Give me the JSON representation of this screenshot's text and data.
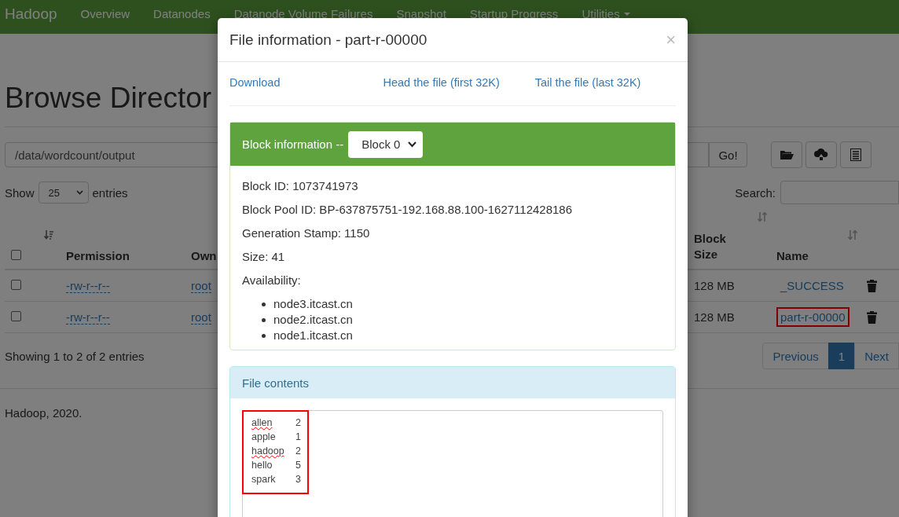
{
  "navbar": {
    "brand": "Hadoop",
    "items": [
      "Overview",
      "Datanodes",
      "Datanode Volume Failures",
      "Snapshot",
      "Startup Progress",
      "Utilities"
    ]
  },
  "page": {
    "title": "Browse Director",
    "path": "/data/wordcount/output",
    "go": "Go!",
    "show_label": "Show",
    "page_size": "25",
    "entries_label": "entries",
    "search_label": "Search:",
    "columns": [
      "Permission",
      "Own",
      "Block Size",
      "Name"
    ],
    "rows": [
      {
        "checked": false,
        "permission": "-rw-r--r--",
        "owner": "root",
        "block_size": "128 MB",
        "name": "_SUCCESS",
        "highlighted": false
      },
      {
        "checked": false,
        "permission": "-rw-r--r--",
        "owner": "root",
        "block_size": "128 MB",
        "name": "part-r-00000",
        "highlighted": true
      }
    ],
    "header_checked": false,
    "summary": "Showing 1 to 2 of 2 entries",
    "pagination": [
      {
        "label": "Previous",
        "selected": false
      },
      {
        "label": "1",
        "selected": true
      },
      {
        "label": "Next",
        "selected": false
      }
    ],
    "footer": "Hadoop, 2020."
  },
  "modal": {
    "title": "File information - part-r-00000",
    "close": "×",
    "links": [
      "Download",
      "Head the file (first 32K)",
      "Tail the file (last 32K)"
    ],
    "block_panel": {
      "title": "Block information --",
      "block": "Block 0",
      "fields": [
        "Block ID: 1073741973",
        "Block Pool ID: BP-637875751-192.168.88.100-1627112428186",
        "Generation Stamp: 1150",
        "Size: 41",
        "Availability:"
      ],
      "nodes": [
        "node3.itcast.cn",
        "node2.itcast.cn",
        "node1.itcast.cn"
      ]
    },
    "contents_panel": {
      "title": "File contents",
      "highlighted": true,
      "lines": [
        {
          "word": "allen",
          "count": "2",
          "misspelled": true
        },
        {
          "word": "apple",
          "count": "1",
          "misspelled": false
        },
        {
          "word": "hadoop",
          "count": "2",
          "misspelled": true
        },
        {
          "word": "hello",
          "count": "5",
          "misspelled": false
        },
        {
          "word": "spark",
          "count": "3",
          "misspelled": false
        }
      ]
    }
  }
}
